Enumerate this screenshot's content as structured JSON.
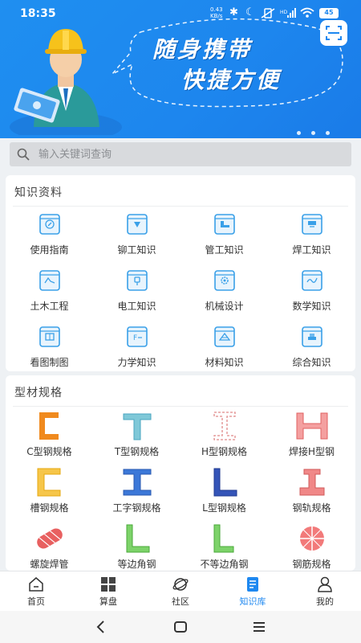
{
  "status_bar": {
    "time": "18:35",
    "net_speed_top": "0.43",
    "net_speed_bottom": "KB/s",
    "battery": "45"
  },
  "banner": {
    "slogan_line1": "随身携带",
    "slogan_line2": "快捷方便",
    "carousel_pages": 3
  },
  "search": {
    "placeholder": "输入关键词查询",
    "value": ""
  },
  "knowledge": {
    "title": "知识资料",
    "items": [
      {
        "label": "使用指南",
        "icon": "compass-book-icon"
      },
      {
        "label": "铆工知识",
        "icon": "rivet-book-icon"
      },
      {
        "label": "管工知识",
        "icon": "pipe-book-icon"
      },
      {
        "label": "焊工知识",
        "icon": "welding-book-icon"
      },
      {
        "label": "土木工程",
        "icon": "civil-book-icon"
      },
      {
        "label": "电工知识",
        "icon": "plug-book-icon"
      },
      {
        "label": "机械设计",
        "icon": "gear-book-icon"
      },
      {
        "label": "数学知识",
        "icon": "formula-book-icon"
      },
      {
        "label": "看图制图",
        "icon": "drawing-book-icon"
      },
      {
        "label": "力学知识",
        "icon": "force-book-icon"
      },
      {
        "label": "材料知识",
        "icon": "material-book-icon"
      },
      {
        "label": "综合知识",
        "icon": "stack-book-icon"
      }
    ]
  },
  "profiles": {
    "title": "型材规格",
    "items": [
      {
        "label": "C型钢规格",
        "icon": "c-steel-icon"
      },
      {
        "label": "T型钢规格",
        "icon": "t-steel-icon"
      },
      {
        "label": "H型钢规格",
        "icon": "h-steel-icon"
      },
      {
        "label": "焊接H型钢",
        "icon": "welded-h-steel-icon"
      },
      {
        "label": "槽钢规格",
        "icon": "channel-steel-icon"
      },
      {
        "label": "工字钢规格",
        "icon": "i-beam-icon"
      },
      {
        "label": "L型钢规格",
        "icon": "l-steel-icon"
      },
      {
        "label": "钢轨规格",
        "icon": "rail-icon"
      },
      {
        "label": "螺旋焊管",
        "icon": "spiral-pipe-icon"
      },
      {
        "label": "等边角钢",
        "icon": "equal-angle-icon"
      },
      {
        "label": "不等边角钢",
        "icon": "unequal-angle-icon"
      },
      {
        "label": "钢筋规格",
        "icon": "rebar-icon"
      }
    ]
  },
  "nav": {
    "items": [
      {
        "label": "首页",
        "icon": "home-icon"
      },
      {
        "label": "算盘",
        "icon": "grid-icon"
      },
      {
        "label": "社区",
        "icon": "planet-icon"
      },
      {
        "label": "知识库",
        "icon": "book-icon",
        "active": true
      },
      {
        "label": "我的",
        "icon": "person-icon"
      }
    ]
  },
  "colors": {
    "accent": "#1e88f0",
    "banner": "#1d86ee",
    "icon_blue": "#3aa0e8"
  }
}
